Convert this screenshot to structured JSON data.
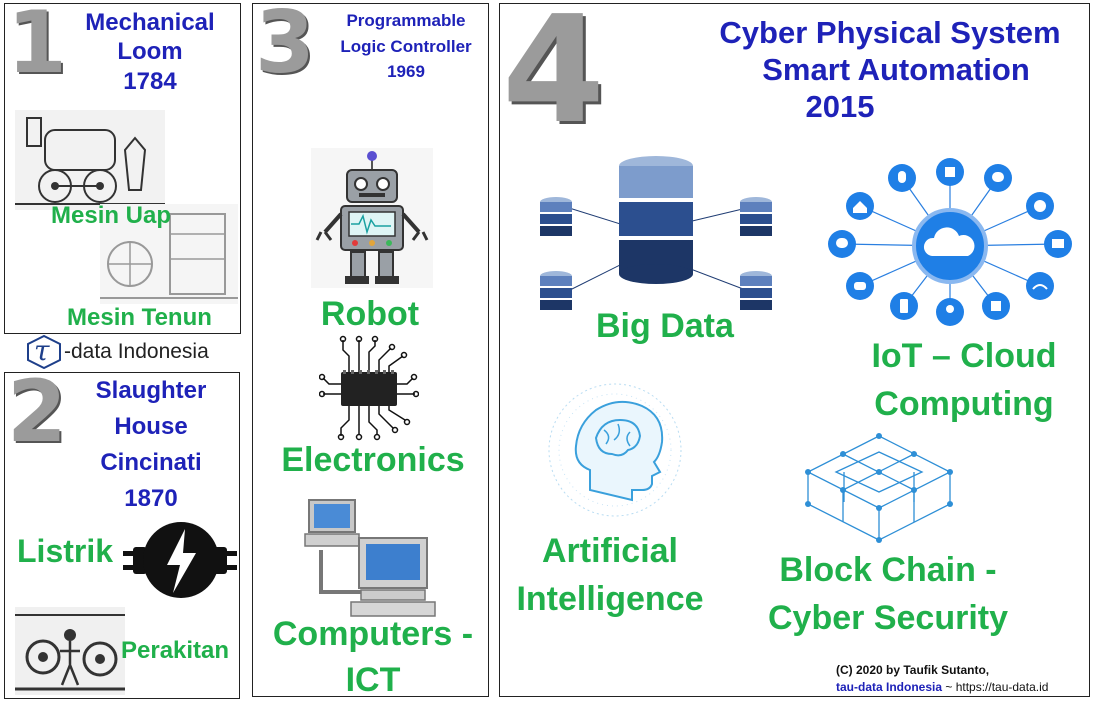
{
  "panels": {
    "p1": {
      "number": "1",
      "title": [
        "Mechanical",
        "Loom",
        "1784"
      ],
      "labels": [
        "Mesin Uap",
        "Mesin Tenun"
      ]
    },
    "logo": {
      "text": "-data Indonesia",
      "glyph": "τ"
    },
    "p2": {
      "number": "2",
      "title": [
        "Slaughter",
        "House",
        "Cincinati",
        "1870"
      ],
      "labels": [
        "Listrik",
        "Perakitan"
      ]
    },
    "p3": {
      "number": "3",
      "title": [
        "Programmable",
        "Logic Controller",
        "1969"
      ],
      "labels": [
        "Robot",
        "Electronics",
        "Computers -",
        "ICT"
      ]
    },
    "p4": {
      "number": "4",
      "title": [
        "Cyber Physical System",
        "Smart Automation",
        "2015"
      ],
      "labels": [
        "Big Data",
        "IoT – Cloud",
        "Computing",
        "Artificial",
        "Intelligence",
        "Block Chain -",
        "Cyber Security"
      ]
    }
  },
  "footer": {
    "line1": "(C) 2020 by Taufik Sutanto,",
    "link": "tau-data Indonesia",
    "tail": " ~ https://tau-data.id"
  },
  "icons": [
    "steam-engine-icon",
    "loom-icon",
    "plug-icon",
    "assembly-line-icon",
    "robot-icon",
    "chip-icon",
    "computer-icon",
    "database-icon",
    "cloud-network-icon",
    "ai-head-icon",
    "blockchain-icon"
  ],
  "colors": {
    "title": "#1e22b8",
    "label": "#20b04b",
    "logo": "#1e3f8a"
  }
}
